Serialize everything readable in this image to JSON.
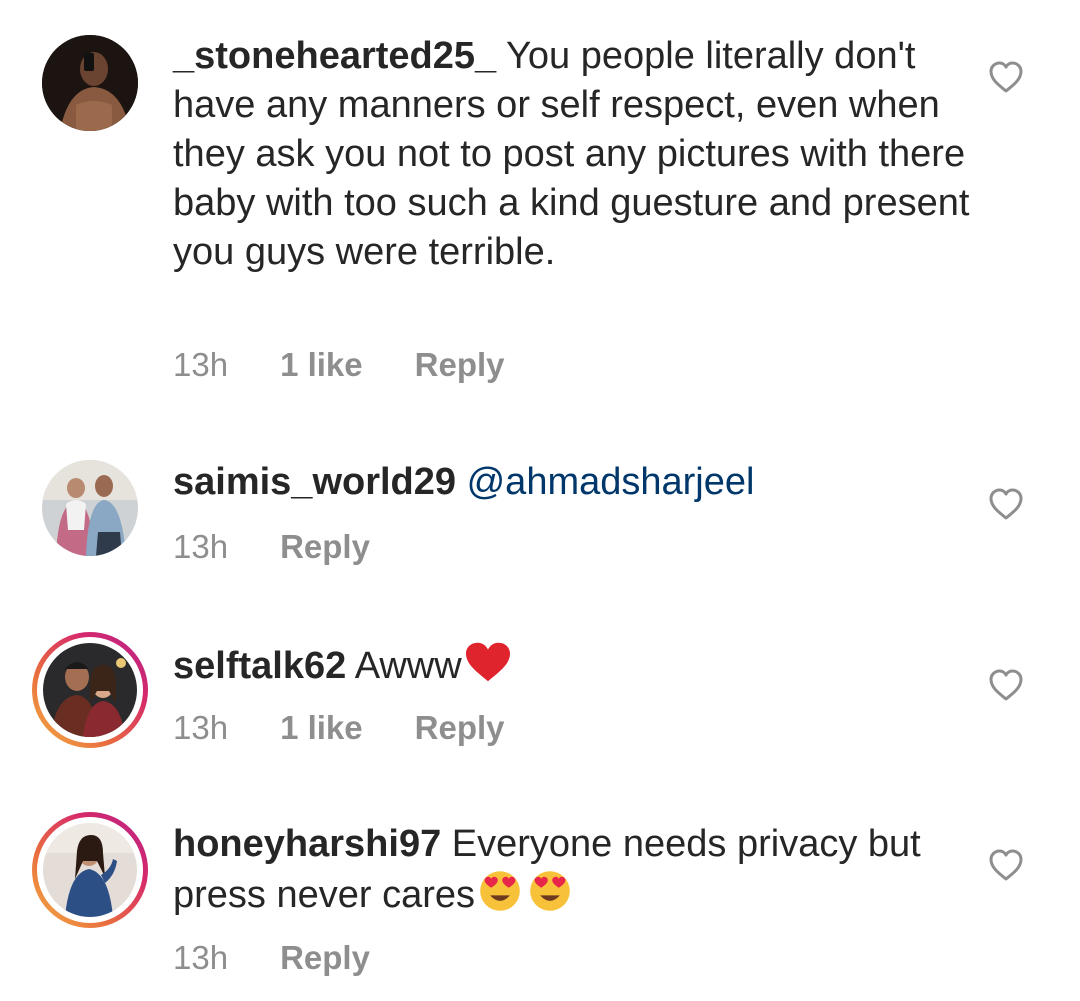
{
  "comments": [
    {
      "username": "_stonehearted25_",
      "text": " You people literally don't have any manners or self respect, even when they ask you not to post any pictures with there baby with too such a kind guesture and present you guys were terrible.",
      "time": "13h",
      "likes": "1 like",
      "reply": "Reply",
      "avatar_icon": "profile-photo",
      "story_ring": false
    },
    {
      "username": "saimis_world29",
      "mention": "@ahmadsharjeel",
      "time": "13h",
      "reply": "Reply",
      "avatar_icon": "profile-photo",
      "story_ring": false
    },
    {
      "username": "selftalk62",
      "text": " Awww",
      "emoji": "red-heart-emoji",
      "time": "13h",
      "likes": "1 like",
      "reply": "Reply",
      "avatar_icon": "profile-photo",
      "story_ring": true
    },
    {
      "username": "honeyharshi97",
      "text": " Everyone needs privacy but press never cares",
      "emoji": "heart-eyes-emoji",
      "time": "13h",
      "reply": "Reply",
      "avatar_icon": "profile-photo",
      "story_ring": true
    }
  ],
  "colors": {
    "text": "#262626",
    "meta": "#8e8e8e",
    "mention": "#00376b",
    "heart_outline": "#8e8e8e",
    "emoji_heart": "#e0242e"
  },
  "icons": {
    "like": "heart-outline-icon"
  }
}
